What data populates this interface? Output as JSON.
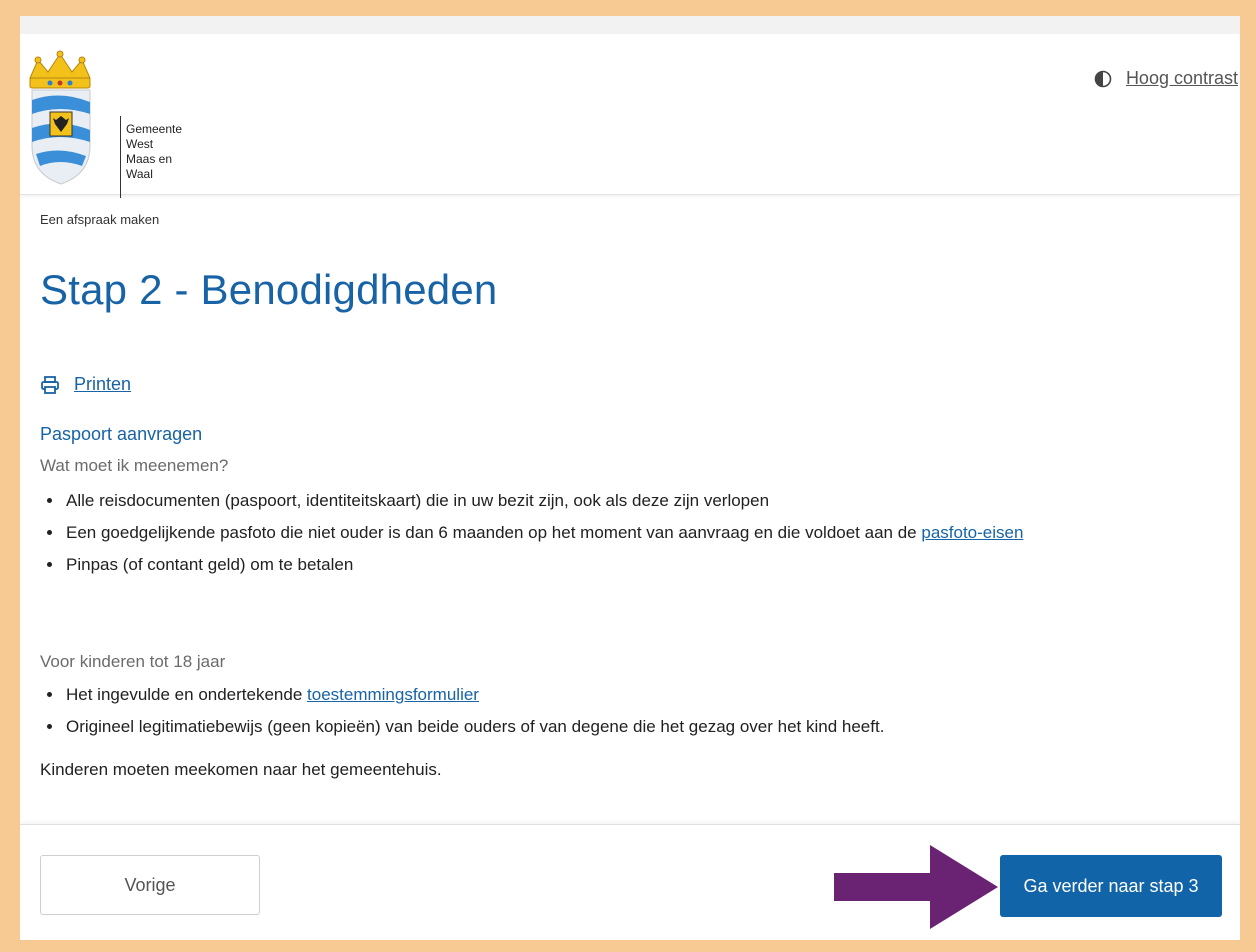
{
  "header": {
    "logo_lines": [
      "Gemeente",
      "West",
      "Maas en",
      "Waal"
    ],
    "contrast_label": "Hoog contrast",
    "contrast_icon": "contrast-icon"
  },
  "breadcrumb": "Een afspraak maken",
  "page_title": "Stap 2 - Benodigdheden",
  "print": {
    "label": "Printen",
    "icon": "printer-icon"
  },
  "content": {
    "section_title": "Paspoort aanvragen",
    "bring": {
      "heading": "Wat moet ik meenemen?",
      "items": [
        {
          "text": "Alle reisdocumenten (paspoort, identiteitskaart) die in uw bezit zijn, ook als deze zijn verlopen"
        },
        {
          "text": "Een goedgelijkende pasfoto die niet ouder is dan 6 maanden op het moment van aanvraag en die voldoet aan de ",
          "link": "pasfoto-eisen"
        },
        {
          "text": "Pinpas (of contant geld) om te betalen"
        }
      ]
    },
    "children": {
      "heading": "Voor kinderen tot 18 jaar",
      "items": [
        {
          "text": "Het ingevulde en ondertekende ",
          "link": "toestemmingsformulier"
        },
        {
          "text": "Origineel legitimatiebewijs (geen kopieën) van beide ouders of van degene die het gezag over het kind heeft."
        }
      ]
    },
    "note": "Kinderen moeten meekomen naar het gemeentehuis."
  },
  "footer": {
    "prev_label": "Vorige",
    "next_label": "Ga verder naar stap 3",
    "arrow_color": "#6a2272",
    "accent_color": "#1264a8"
  }
}
